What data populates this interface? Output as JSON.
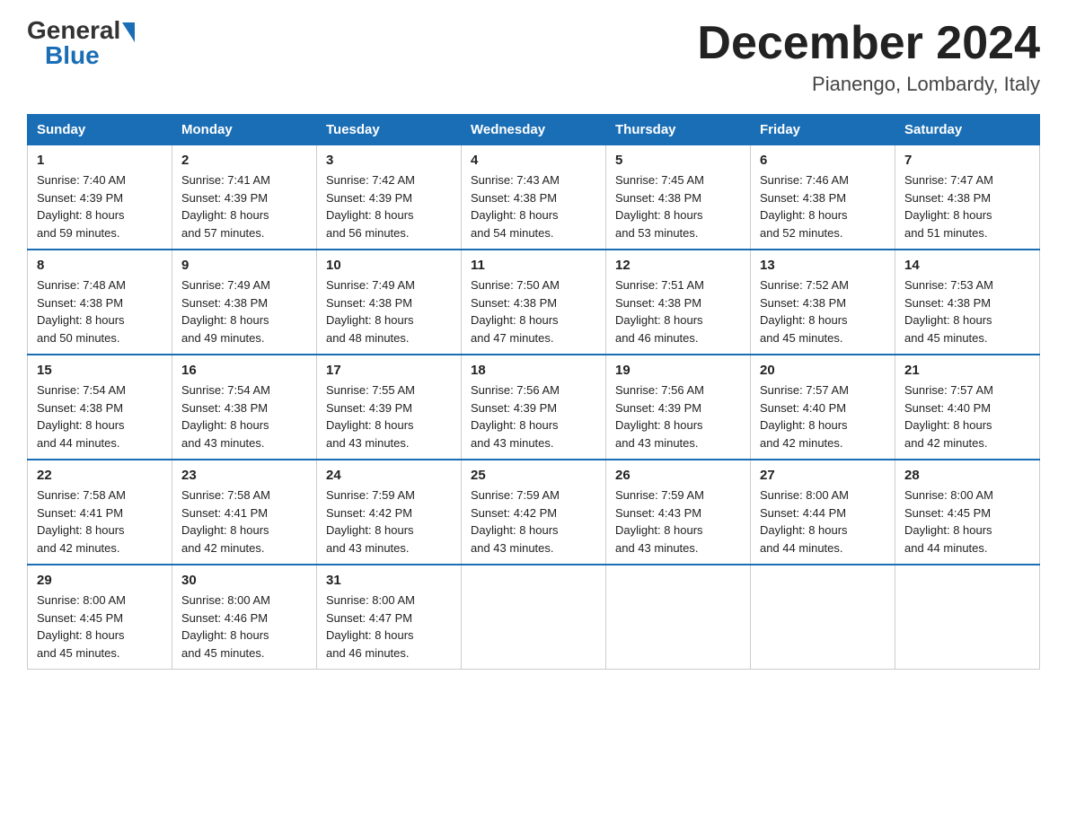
{
  "header": {
    "logo_general": "General",
    "logo_blue": "Blue",
    "month_title": "December 2024",
    "location": "Pianengo, Lombardy, Italy"
  },
  "weekdays": [
    "Sunday",
    "Monday",
    "Tuesday",
    "Wednesday",
    "Thursday",
    "Friday",
    "Saturday"
  ],
  "weeks": [
    [
      {
        "day": "1",
        "sunrise": "7:40 AM",
        "sunset": "4:39 PM",
        "daylight": "8 hours and 59 minutes."
      },
      {
        "day": "2",
        "sunrise": "7:41 AM",
        "sunset": "4:39 PM",
        "daylight": "8 hours and 57 minutes."
      },
      {
        "day": "3",
        "sunrise": "7:42 AM",
        "sunset": "4:39 PM",
        "daylight": "8 hours and 56 minutes."
      },
      {
        "day": "4",
        "sunrise": "7:43 AM",
        "sunset": "4:38 PM",
        "daylight": "8 hours and 54 minutes."
      },
      {
        "day": "5",
        "sunrise": "7:45 AM",
        "sunset": "4:38 PM",
        "daylight": "8 hours and 53 minutes."
      },
      {
        "day": "6",
        "sunrise": "7:46 AM",
        "sunset": "4:38 PM",
        "daylight": "8 hours and 52 minutes."
      },
      {
        "day": "7",
        "sunrise": "7:47 AM",
        "sunset": "4:38 PM",
        "daylight": "8 hours and 51 minutes."
      }
    ],
    [
      {
        "day": "8",
        "sunrise": "7:48 AM",
        "sunset": "4:38 PM",
        "daylight": "8 hours and 50 minutes."
      },
      {
        "day": "9",
        "sunrise": "7:49 AM",
        "sunset": "4:38 PM",
        "daylight": "8 hours and 49 minutes."
      },
      {
        "day": "10",
        "sunrise": "7:49 AM",
        "sunset": "4:38 PM",
        "daylight": "8 hours and 48 minutes."
      },
      {
        "day": "11",
        "sunrise": "7:50 AM",
        "sunset": "4:38 PM",
        "daylight": "8 hours and 47 minutes."
      },
      {
        "day": "12",
        "sunrise": "7:51 AM",
        "sunset": "4:38 PM",
        "daylight": "8 hours and 46 minutes."
      },
      {
        "day": "13",
        "sunrise": "7:52 AM",
        "sunset": "4:38 PM",
        "daylight": "8 hours and 45 minutes."
      },
      {
        "day": "14",
        "sunrise": "7:53 AM",
        "sunset": "4:38 PM",
        "daylight": "8 hours and 45 minutes."
      }
    ],
    [
      {
        "day": "15",
        "sunrise": "7:54 AM",
        "sunset": "4:38 PM",
        "daylight": "8 hours and 44 minutes."
      },
      {
        "day": "16",
        "sunrise": "7:54 AM",
        "sunset": "4:38 PM",
        "daylight": "8 hours and 43 minutes."
      },
      {
        "day": "17",
        "sunrise": "7:55 AM",
        "sunset": "4:39 PM",
        "daylight": "8 hours and 43 minutes."
      },
      {
        "day": "18",
        "sunrise": "7:56 AM",
        "sunset": "4:39 PM",
        "daylight": "8 hours and 43 minutes."
      },
      {
        "day": "19",
        "sunrise": "7:56 AM",
        "sunset": "4:39 PM",
        "daylight": "8 hours and 43 minutes."
      },
      {
        "day": "20",
        "sunrise": "7:57 AM",
        "sunset": "4:40 PM",
        "daylight": "8 hours and 42 minutes."
      },
      {
        "day": "21",
        "sunrise": "7:57 AM",
        "sunset": "4:40 PM",
        "daylight": "8 hours and 42 minutes."
      }
    ],
    [
      {
        "day": "22",
        "sunrise": "7:58 AM",
        "sunset": "4:41 PM",
        "daylight": "8 hours and 42 minutes."
      },
      {
        "day": "23",
        "sunrise": "7:58 AM",
        "sunset": "4:41 PM",
        "daylight": "8 hours and 42 minutes."
      },
      {
        "day": "24",
        "sunrise": "7:59 AM",
        "sunset": "4:42 PM",
        "daylight": "8 hours and 43 minutes."
      },
      {
        "day": "25",
        "sunrise": "7:59 AM",
        "sunset": "4:42 PM",
        "daylight": "8 hours and 43 minutes."
      },
      {
        "day": "26",
        "sunrise": "7:59 AM",
        "sunset": "4:43 PM",
        "daylight": "8 hours and 43 minutes."
      },
      {
        "day": "27",
        "sunrise": "8:00 AM",
        "sunset": "4:44 PM",
        "daylight": "8 hours and 44 minutes."
      },
      {
        "day": "28",
        "sunrise": "8:00 AM",
        "sunset": "4:45 PM",
        "daylight": "8 hours and 44 minutes."
      }
    ],
    [
      {
        "day": "29",
        "sunrise": "8:00 AM",
        "sunset": "4:45 PM",
        "daylight": "8 hours and 45 minutes."
      },
      {
        "day": "30",
        "sunrise": "8:00 AM",
        "sunset": "4:46 PM",
        "daylight": "8 hours and 45 minutes."
      },
      {
        "day": "31",
        "sunrise": "8:00 AM",
        "sunset": "4:47 PM",
        "daylight": "8 hours and 46 minutes."
      },
      null,
      null,
      null,
      null
    ]
  ],
  "labels": {
    "sunrise": "Sunrise:",
    "sunset": "Sunset:",
    "daylight": "Daylight:"
  }
}
